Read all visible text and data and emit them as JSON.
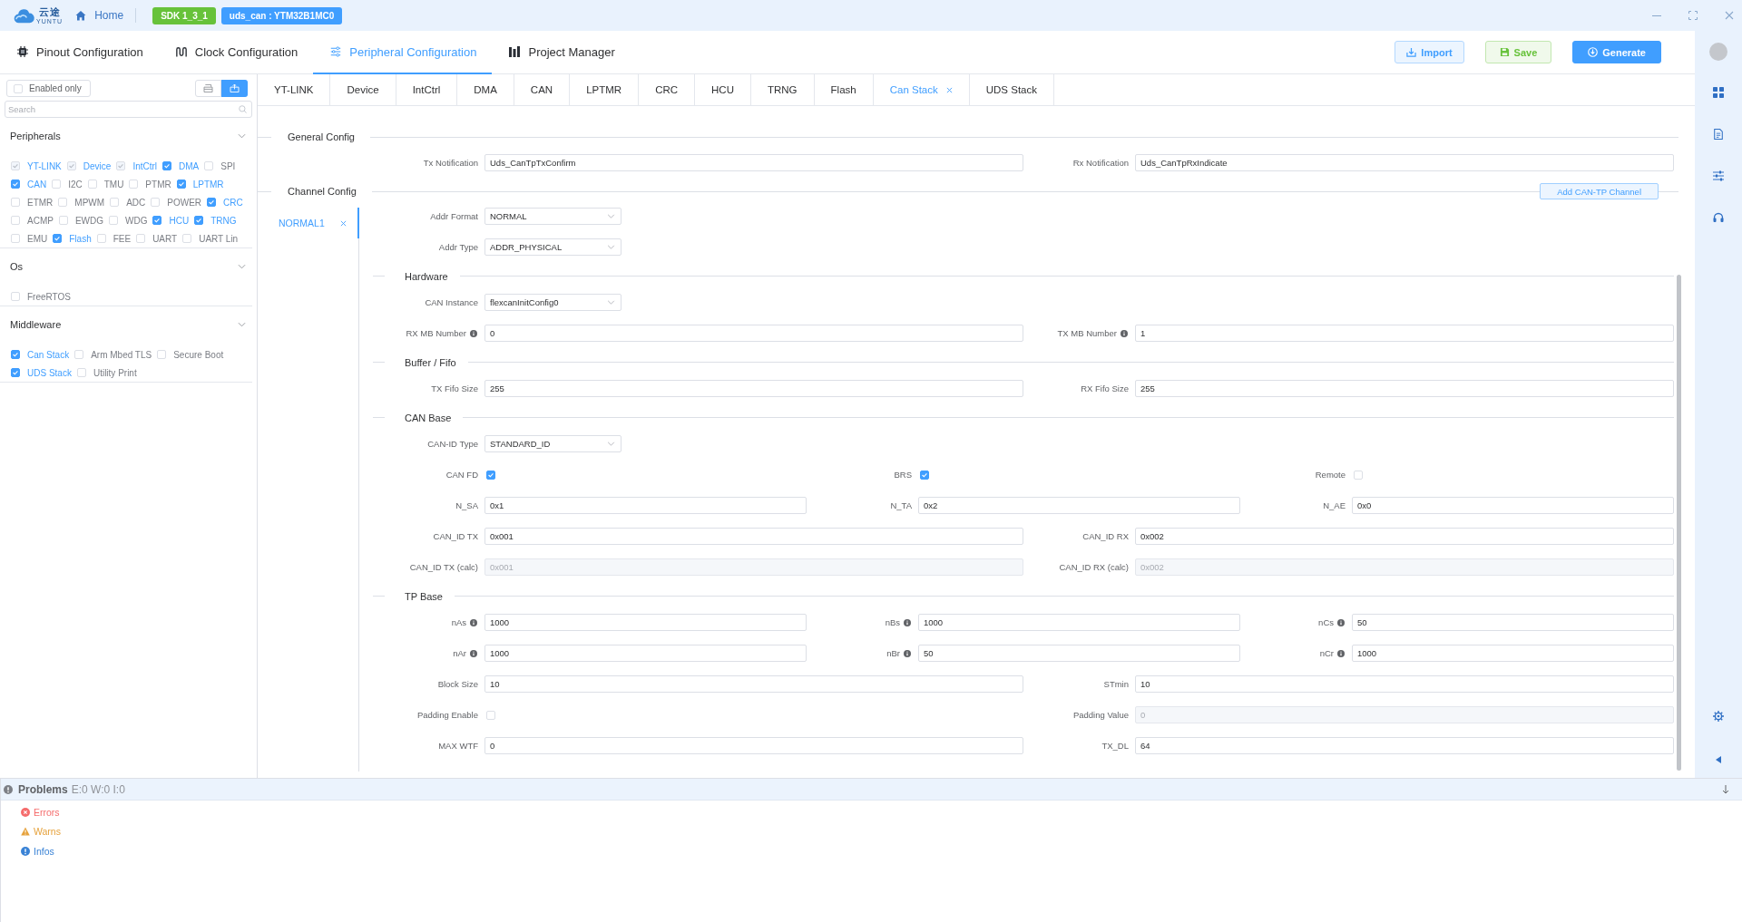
{
  "title_bar": {
    "logo_text": "云途",
    "logo_tagline": "YUNTU",
    "home": "Home",
    "badges": [
      {
        "label": "SDK 1_3_1",
        "color": "#67c23a"
      },
      {
        "label": "uds_can : YTM32B1MC0",
        "color": "#409eff"
      }
    ]
  },
  "main_tabs": [
    {
      "label": "Pinout Configuration",
      "selected": false
    },
    {
      "label": "Clock Configuration",
      "selected": false
    },
    {
      "label": "Peripheral Configuration",
      "selected": true
    },
    {
      "label": "Project Manager",
      "selected": false
    }
  ],
  "actions": [
    {
      "label": "Import",
      "kind": "import"
    },
    {
      "label": "Save",
      "kind": "save"
    },
    {
      "label": "Generate",
      "kind": "generate"
    }
  ],
  "sidebar": {
    "enabled_only": {
      "label": "Enabled only",
      "checked": false
    },
    "view_toggle": [
      {
        "selected": false
      },
      {
        "selected": true
      }
    ],
    "search": {
      "placeholder": "Search"
    },
    "groups": [
      {
        "title": "Peripherals",
        "expanded": true,
        "items": [
          {
            "label": "YT-LINK",
            "checked": true,
            "disabled": true
          },
          {
            "label": "Device",
            "checked": true,
            "disabled": true
          },
          {
            "label": "IntCtrl",
            "checked": true,
            "disabled": true
          },
          {
            "label": "DMA",
            "checked": true,
            "disabled": false
          },
          {
            "label": "SPI",
            "checked": false,
            "disabled": false
          },
          {
            "label": "CAN",
            "checked": true,
            "disabled": false
          },
          {
            "label": "I2C",
            "checked": false,
            "disabled": false
          },
          {
            "label": "TMU",
            "checked": false,
            "disabled": false
          },
          {
            "label": "PTMR",
            "checked": false,
            "disabled": false
          },
          {
            "label": "LPTMR",
            "checked": true,
            "disabled": false
          },
          {
            "label": "ETMR",
            "checked": false,
            "disabled": false
          },
          {
            "label": "MPWM",
            "checked": false,
            "disabled": false
          },
          {
            "label": "ADC",
            "checked": false,
            "disabled": false
          },
          {
            "label": "POWER",
            "checked": false,
            "disabled": false
          },
          {
            "label": "CRC",
            "checked": true,
            "disabled": false
          },
          {
            "label": "ACMP",
            "checked": false,
            "disabled": false
          },
          {
            "label": "EWDG",
            "checked": false,
            "disabled": false
          },
          {
            "label": "WDG",
            "checked": false,
            "disabled": false
          },
          {
            "label": "HCU",
            "checked": true,
            "disabled": false
          },
          {
            "label": "TRNG",
            "checked": true,
            "disabled": false
          },
          {
            "label": "EMU",
            "checked": false,
            "disabled": false
          },
          {
            "label": "Flash",
            "checked": true,
            "disabled": false
          },
          {
            "label": "FEE",
            "checked": false,
            "disabled": false
          },
          {
            "label": "UART",
            "checked": false,
            "disabled": false
          },
          {
            "label": "UART Lin",
            "checked": false,
            "disabled": false
          }
        ]
      },
      {
        "title": "Os",
        "expanded": true,
        "items": [
          {
            "label": "FreeRTOS",
            "checked": false,
            "disabled": false
          }
        ]
      },
      {
        "title": "Middleware",
        "expanded": true,
        "items": [
          {
            "label": "Can Stack",
            "checked": true,
            "disabled": false
          },
          {
            "label": "Arm Mbed TLS",
            "checked": false,
            "disabled": false
          },
          {
            "label": "Secure Boot",
            "checked": false,
            "disabled": false
          },
          {
            "label": "UDS Stack",
            "checked": true,
            "disabled": false
          },
          {
            "label": "Utility Print",
            "checked": false,
            "disabled": false
          }
        ]
      }
    ]
  },
  "sub_tabs": [
    {
      "label": "YT-LINK",
      "selected": false,
      "closable": false
    },
    {
      "label": "Device",
      "selected": false,
      "closable": false
    },
    {
      "label": "IntCtrl",
      "selected": false,
      "closable": false
    },
    {
      "label": "DMA",
      "selected": false,
      "closable": false
    },
    {
      "label": "CAN",
      "selected": false,
      "closable": false
    },
    {
      "label": "LPTMR",
      "selected": false,
      "closable": false
    },
    {
      "label": "CRC",
      "selected": false,
      "closable": false
    },
    {
      "label": "HCU",
      "selected": false,
      "closable": false
    },
    {
      "label": "TRNG",
      "selected": false,
      "closable": false
    },
    {
      "label": "Flash",
      "selected": false,
      "closable": false
    },
    {
      "label": "Can Stack",
      "selected": true,
      "closable": true
    },
    {
      "label": "UDS Stack",
      "selected": false,
      "closable": false
    }
  ],
  "general_config": {
    "title": "General Config",
    "fields": [
      {
        "label": "Tx Notification",
        "value": "Uds_CanTpTxConfirm"
      },
      {
        "label": "Rx Notification",
        "value": "Uds_CanTpRxIndicate"
      }
    ]
  },
  "channel_config": {
    "title": "Channel Config",
    "add_button": "Add CAN-TP Channel",
    "channels": [
      {
        "label": "NORMAL1",
        "selected": true
      }
    ],
    "sections": [
      {
        "rows": [
          {
            "fields": [
              {
                "kind": "select",
                "label": "Addr Format",
                "value": "NORMAL"
              }
            ]
          },
          {
            "fields": [
              {
                "kind": "select",
                "label": "Addr Type",
                "value": "ADDR_PHYSICAL"
              }
            ]
          }
        ]
      },
      {
        "title": "Hardware",
        "rows": [
          {
            "fields": [
              {
                "kind": "select",
                "label": "CAN Instance",
                "value": "flexcanInitConfig0"
              }
            ]
          },
          {
            "fields": [
              {
                "kind": "input",
                "label": "RX MB Number",
                "info": true,
                "value": "0",
                "disabled": false
              },
              {
                "kind": "input",
                "label": "TX MB Number",
                "info": true,
                "value": "1",
                "disabled": false
              }
            ]
          }
        ]
      },
      {
        "title": "Buffer / Fifo",
        "rows": [
          {
            "fields": [
              {
                "kind": "input",
                "label": "TX Fifo Size",
                "info": false,
                "value": "255",
                "disabled": false
              },
              {
                "kind": "input",
                "label": "RX Fifo Size",
                "info": false,
                "value": "255",
                "disabled": false
              }
            ]
          }
        ]
      },
      {
        "title": "CAN Base",
        "rows": [
          {
            "fields": [
              {
                "kind": "select",
                "label": "CAN-ID Type",
                "value": "STANDARD_ID"
              }
            ]
          },
          {
            "fields": [
              {
                "kind": "checkbox",
                "label": "CAN FD",
                "checked": true
              },
              {
                "kind": "checkbox",
                "label": "BRS",
                "checked": true
              },
              {
                "kind": "checkbox",
                "label": "Remote",
                "checked": false
              }
            ]
          },
          {
            "fields": [
              {
                "kind": "input",
                "label": "N_SA",
                "info": false,
                "value": "0x1",
                "disabled": false
              },
              {
                "kind": "input",
                "label": "N_TA",
                "info": false,
                "value": "0x2",
                "disabled": false
              },
              {
                "kind": "input",
                "label": "N_AE",
                "info": false,
                "value": "0x0",
                "disabled": false
              }
            ]
          },
          {
            "fields": [
              {
                "kind": "input",
                "label": "CAN_ID TX",
                "info": false,
                "value": "0x001",
                "disabled": false
              },
              {
                "kind": "input",
                "label": "CAN_ID RX",
                "info": false,
                "value": "0x002",
                "disabled": false
              }
            ]
          },
          {
            "fields": [
              {
                "kind": "input",
                "label": "CAN_ID TX (calc)",
                "info": false,
                "value": "0x001",
                "disabled": true
              },
              {
                "kind": "input",
                "label": "CAN_ID RX (calc)",
                "info": false,
                "value": "0x002",
                "disabled": true
              }
            ]
          }
        ]
      },
      {
        "title": "TP Base",
        "rows": [
          {
            "fields": [
              {
                "kind": "input",
                "label": "nAs",
                "info": true,
                "value": "1000",
                "disabled": false
              },
              {
                "kind": "input",
                "label": "nBs",
                "info": true,
                "value": "1000",
                "disabled": false
              },
              {
                "kind": "input",
                "label": "nCs",
                "info": true,
                "value": "50",
                "disabled": false
              }
            ]
          },
          {
            "fields": [
              {
                "kind": "input",
                "label": "nAr",
                "info": true,
                "value": "1000",
                "disabled": false
              },
              {
                "kind": "input",
                "label": "nBr",
                "info": true,
                "value": "50",
                "disabled": false
              },
              {
                "kind": "input",
                "label": "nCr",
                "info": true,
                "value": "1000",
                "disabled": false
              }
            ]
          },
          {
            "fields": [
              {
                "kind": "input",
                "label": "Block Size",
                "info": false,
                "value": "10",
                "disabled": false
              },
              {
                "kind": "input",
                "label": "STmin",
                "info": false,
                "value": "10",
                "disabled": false
              }
            ]
          },
          {
            "fields": [
              {
                "kind": "checkbox",
                "label": "Padding Enable",
                "checked": false
              },
              {
                "kind": "input",
                "label": "Padding Value",
                "info": false,
                "value": "0",
                "disabled": true
              }
            ]
          },
          {
            "fields": [
              {
                "kind": "input",
                "label": "MAX WTF",
                "info": false,
                "value": "0",
                "disabled": false
              },
              {
                "kind": "input",
                "label": "TX_DL",
                "info": false,
                "value": "64",
                "disabled": false
              }
            ]
          }
        ]
      }
    ]
  },
  "problems": {
    "title": "Problems",
    "summary": "E:0 W:0 I:0",
    "items": [
      {
        "label": "Errors",
        "kind": "error"
      },
      {
        "label": "Warns",
        "kind": "warning"
      },
      {
        "label": "Infos",
        "kind": "info"
      }
    ]
  }
}
